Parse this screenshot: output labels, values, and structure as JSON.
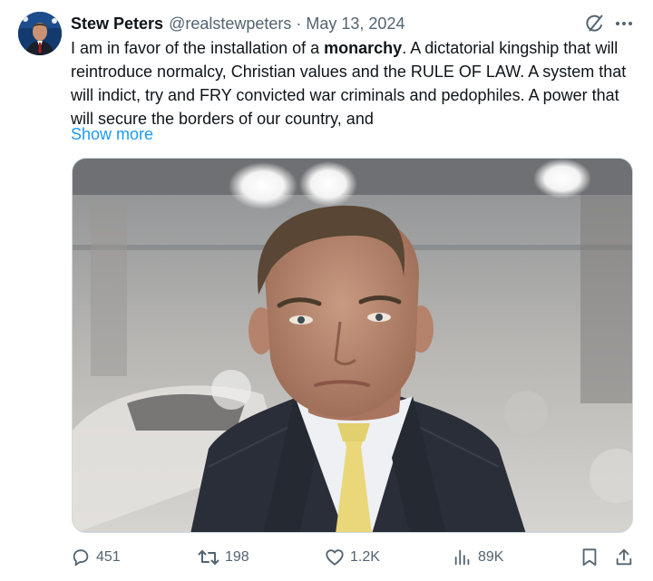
{
  "author": {
    "display_name": "Stew Peters",
    "handle": "@realstewpeters",
    "separator": "·",
    "date": "May 13, 2024"
  },
  "tweet": {
    "text_before": "I am in favor of the installation of a ",
    "text_bold": "monarchy",
    "text_after": ". A dictatorial kingship that will reintroduce normalcy, Christian values and the RULE OF LAW. A system that will indict, try and FRY convicted war criminals and pedophiles. A power that will secure the borders of our country, and",
    "show_more": "Show more"
  },
  "actions": {
    "replies": "451",
    "reposts": "198",
    "likes": "1.2K",
    "views": "89K"
  },
  "icons": {
    "grok": "grok-icon",
    "more": "more-icon",
    "reply": "reply-icon",
    "repost": "repost-icon",
    "like": "heart-icon",
    "views": "views-icon",
    "bookmark": "bookmark-icon",
    "share": "share-icon"
  },
  "colors": {
    "link": "#1d9bf0",
    "secondary_text": "#536471",
    "primary_text": "#0f1419"
  }
}
